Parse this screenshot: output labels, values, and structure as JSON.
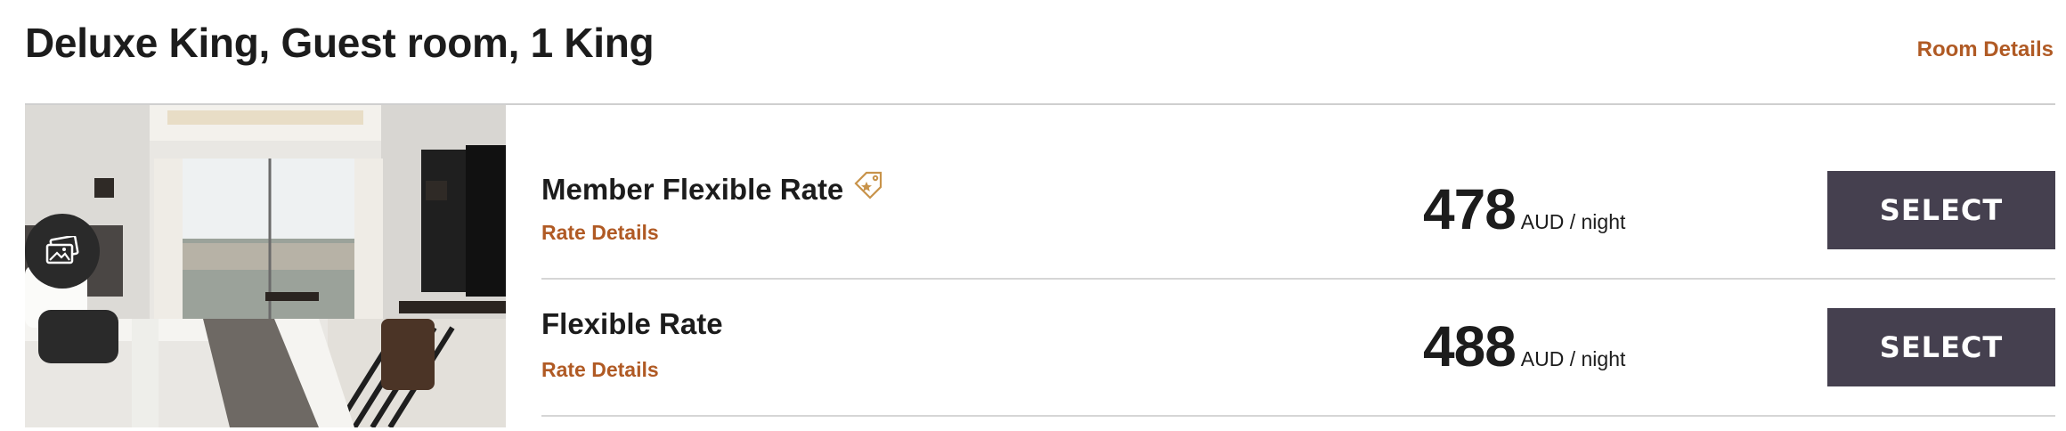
{
  "room": {
    "title": "Deluxe King, Guest room, 1 King",
    "details_link": "Room Details"
  },
  "rates": [
    {
      "name": "Member Flexible Rate",
      "details_link": "Rate Details",
      "price": "478",
      "unit": "AUD / night",
      "button": "SELECT",
      "has_member_tag": true
    },
    {
      "name": "Flexible Rate",
      "details_link": "Rate Details",
      "price": "488",
      "unit": "AUD / night",
      "button": "SELECT",
      "has_member_tag": false
    }
  ],
  "icons": {
    "gallery": "gallery-icon",
    "member_tag": "price-tag-icon"
  },
  "colors": {
    "accent": "#b05a24",
    "button_bg": "#45404f",
    "text": "#1c1c1c"
  }
}
